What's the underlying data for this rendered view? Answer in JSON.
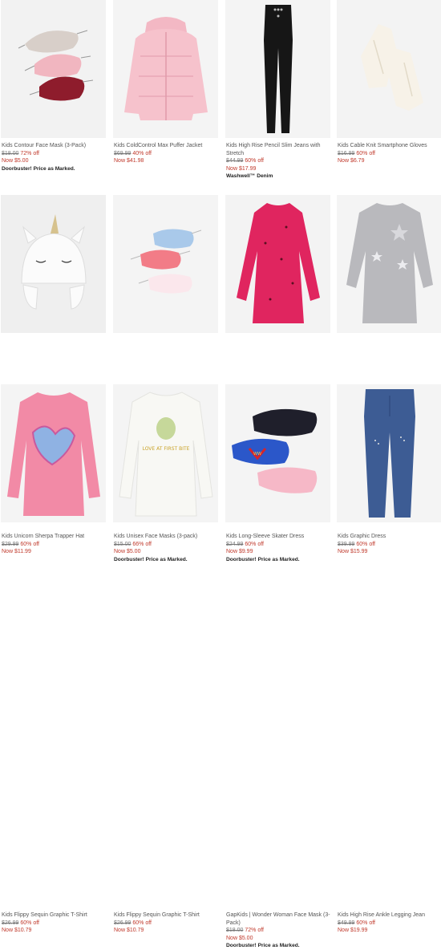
{
  "products": [
    {
      "name": "Kids Contour Face Mask (3-Pack)",
      "orig": "$18.00",
      "pct": "72% off",
      "now": "Now $5.00",
      "promo": "Doorbuster! Price as Marked."
    },
    {
      "name": "Kids ColdControl Max Puffer Jacket",
      "orig": "$69.99",
      "pct": "40% off",
      "now": "Now $41.98",
      "promo": ""
    },
    {
      "name": "Kids High Rise Pencil Slim Jeans with Stretch",
      "orig": "$44.99",
      "pct": "60% off",
      "now": "Now $17.99",
      "promo": "Washwell™ Denim"
    },
    {
      "name": "Kids Cable Knit Smartphone Gloves",
      "orig": "$16.99",
      "pct": "60% off",
      "now": "Now $6.79",
      "promo": ""
    },
    {
      "name": "Kids Unicorn Sherpa Trapper Hat",
      "orig": "$29.99",
      "pct": "60% off",
      "now": "Now $11.99",
      "promo": ""
    },
    {
      "name": "Kids Unisex Face Masks (3-pack)",
      "orig": "$15.00",
      "pct": "66% off",
      "now": "Now $5.00",
      "promo": "Doorbuster! Price as Marked."
    },
    {
      "name": "Kids Long-Sleeve Skater Dress",
      "orig": "$24.99",
      "pct": "60% off",
      "now": "Now $9.99",
      "promo": "Doorbuster! Price as Marked."
    },
    {
      "name": "Kids Graphic Dress",
      "orig": "$39.99",
      "pct": "60% off",
      "now": "Now $15.99",
      "promo": ""
    },
    {
      "name": "Kids Flippy Sequin Graphic T-Shirt",
      "orig": "$26.99",
      "pct": "60% off",
      "now": "Now $10.79",
      "promo": ""
    },
    {
      "name": "Kids Flippy Sequin Graphic T-Shirt",
      "orig": "$26.99",
      "pct": "60% off",
      "now": "Now $10.79",
      "promo": ""
    },
    {
      "name": "GapKids | Wonder Woman Face Mask (3-Pack)",
      "orig": "$18.00",
      "pct": "72% off",
      "now": "Now $5.00",
      "promo": "Doorbuster! Price as Marked."
    },
    {
      "name": "Kids High Rise Ankle Legging Jean",
      "orig": "$49.99",
      "pct": "60% off",
      "now": "Now $19.99",
      "promo": ""
    }
  ],
  "graphics": {
    "tee_print": "LOVE AT FIRST BITE",
    "mask_logo": "WW"
  }
}
